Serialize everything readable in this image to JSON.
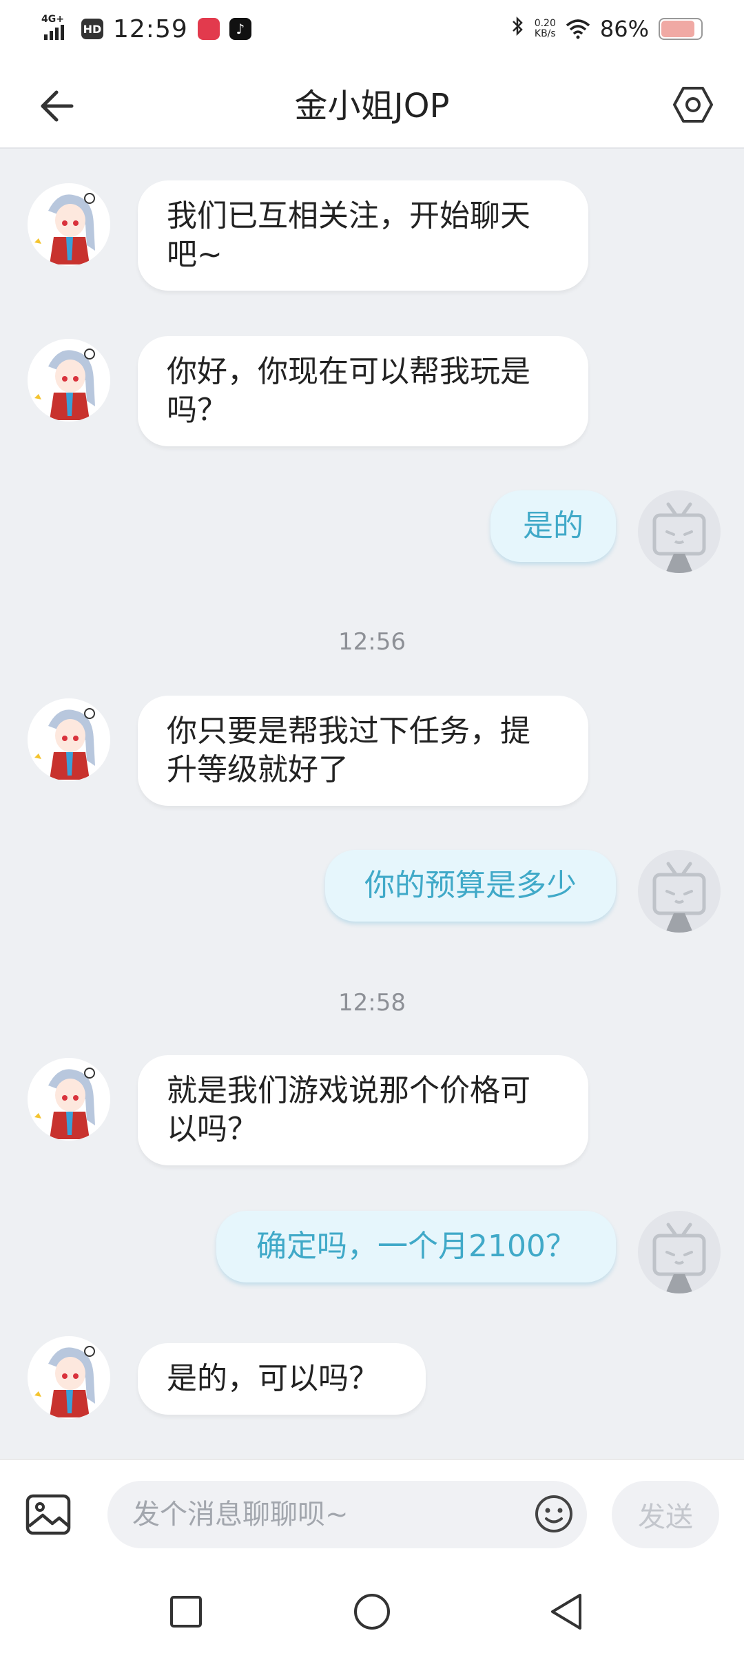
{
  "status_bar": {
    "network": "4G+",
    "hd": "HD",
    "time": "12:59",
    "speed_value": "0.20",
    "speed_unit": "KB/s",
    "battery": "86%",
    "battery_level": 0.86,
    "icons": [
      "signal-icon",
      "hd-icon",
      "app-notification-icon",
      "tiktok-icon",
      "bluetooth-icon",
      "wifi-icon",
      "battery-icon"
    ]
  },
  "header": {
    "title": "金小姐JOP",
    "back_icon": "back-arrow-icon",
    "settings_icon": "settings-hexagon-icon"
  },
  "messages": [
    {
      "sender": "peer",
      "lines": [
        "我们已互相关注，开始聊天",
        "吧~"
      ]
    },
    {
      "sender": "peer",
      "lines": [
        "你好，你现在可以帮我玩是",
        "吗？"
      ]
    },
    {
      "sender": "me",
      "lines": [
        "是的"
      ]
    },
    {
      "type": "timestamp",
      "text": "12:56"
    },
    {
      "sender": "peer",
      "lines": [
        "你只要是帮我过下任务，提",
        "升等级就好了"
      ]
    },
    {
      "sender": "me",
      "lines": [
        "你的预算是多少"
      ]
    },
    {
      "type": "timestamp",
      "text": "12:58"
    },
    {
      "sender": "peer",
      "lines": [
        "就是我们游戏说那个价格可",
        "以吗？"
      ]
    },
    {
      "sender": "me",
      "lines": [
        "确定吗，一个月2100？"
      ]
    },
    {
      "sender": "peer",
      "lines": [
        "是的，可以吗？"
      ]
    }
  ],
  "input_bar": {
    "placeholder": "发个消息聊聊呗~",
    "send_label": "发送",
    "image_icon": "image-icon",
    "emoji_icon": "emoji-icon"
  },
  "nav_bar": {
    "icons": [
      "recent-apps-icon",
      "home-icon",
      "back-triangle-icon"
    ]
  },
  "colors": {
    "background": "#eef0f3",
    "incoming_bubble": "#ffffff",
    "outgoing_bubble": "#e6f6fc",
    "outgoing_text": "#40a9c8",
    "timestamp": "#8d9096"
  }
}
